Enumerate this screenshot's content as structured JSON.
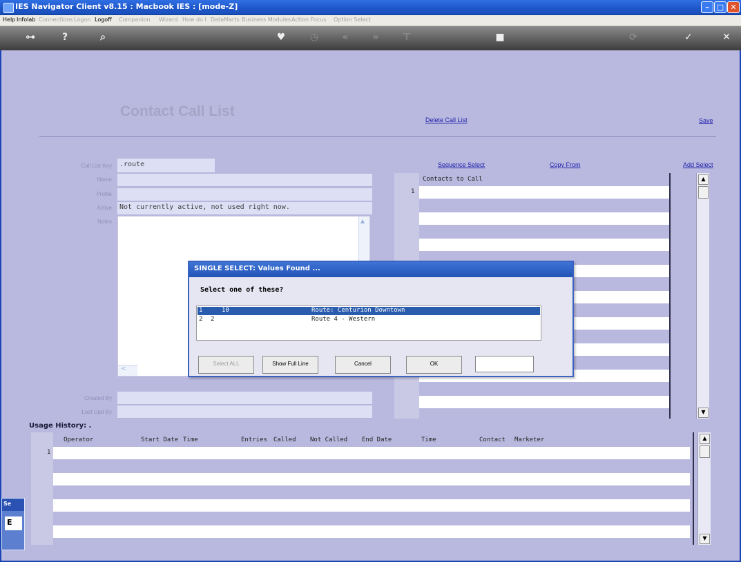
{
  "window": {
    "title": "IES Navigator Client v8.15 : Macbook IES :      [mode-Z]"
  },
  "menu": [
    "Help",
    "Infolab",
    "Connections",
    "Logon",
    "Logoff",
    "Companion",
    "Wizard",
    "How do I",
    "DataMarts",
    "Business Modules",
    "Action Focus",
    "Option Select"
  ],
  "toolbar": [
    "key-icon",
    "help-icon",
    "search-icon",
    "heart-icon",
    "clock-icon",
    "rewind-icon",
    "forward-icon",
    "tree-icon",
    "stop-icon",
    "refresh-icon",
    "check-icon",
    "close-icon"
  ],
  "page": {
    "title": "Contact Call List",
    "delete_link": "Delete Call List",
    "save_link": "Save",
    "sequence_select": "Sequence Select",
    "copy_from": "Copy From",
    "add_select": "Add Select"
  },
  "form": {
    "call_list_key_label": "Call List Key",
    "call_list_key_value": ".route",
    "name_label": "Name",
    "profile_label": "Profile",
    "active_label": "Active",
    "active_value": "Not currently active, not used right now.",
    "notes_label": "Notes",
    "created_by_label": "Created By",
    "last_upd_label": "Last Upd By"
  },
  "contacts": {
    "header": "Contacts to Call",
    "row_num": "1"
  },
  "usage": {
    "title": "Usage History: .",
    "columns": [
      "Operator",
      "Start Date",
      "Time",
      "Entries",
      "Called",
      "Not Called",
      "End Date",
      "Time",
      "Contact",
      "Marketer"
    ],
    "row_num": "1"
  },
  "dialog": {
    "title": "SINGLE SELECT: Values Found ...",
    "prompt": "Select one of these?",
    "rows": [
      {
        "n": "1",
        "code": "10",
        "desc": "Route: Centurion Downtown"
      },
      {
        "n": "2",
        "code": "2",
        "desc": "Route 4 - Western"
      }
    ],
    "buttons": {
      "select_all": "Select ALL",
      "show_full": "Show Full Line",
      "cancel": "Cancel",
      "ok": "OK"
    }
  },
  "side_tab": {
    "label": "Se",
    "glyph": "E"
  },
  "colors": {
    "background": "#b9b9e0",
    "titlebar": "#1d56c9",
    "selection": "#2a5cae"
  }
}
